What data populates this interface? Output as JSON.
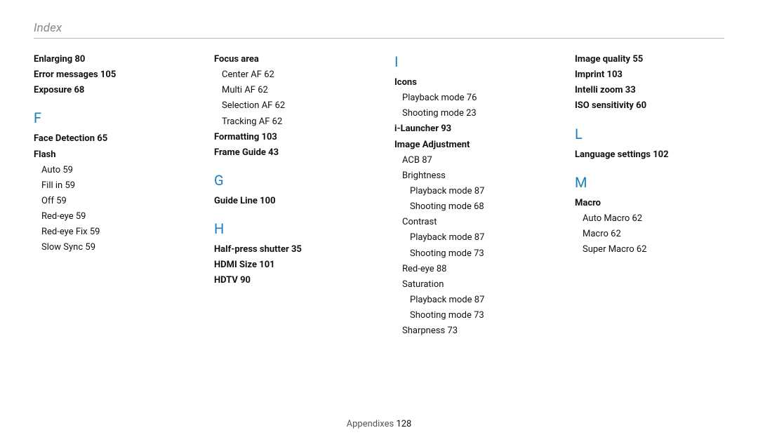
{
  "header": "Index",
  "footer_section": "Appendixes",
  "footer_page": "128",
  "col1": {
    "e1": {
      "label": "Enlarging",
      "page": "80"
    },
    "e2": {
      "label": "Error messages",
      "page": "105"
    },
    "e3": {
      "label": "Exposure",
      "page": "68"
    },
    "letter_f": "F",
    "f1": {
      "label": "Face Detection",
      "page": "65"
    },
    "f2": {
      "label": "Flash"
    },
    "f2a": {
      "label": "Auto",
      "page": "59"
    },
    "f2b": {
      "label": "Fill in",
      "page": "59"
    },
    "f2c": {
      "label": "Off",
      "page": "59"
    },
    "f2d": {
      "label": "Red-eye",
      "page": "59"
    },
    "f2e": {
      "label": "Red-eye Fix",
      "page": "59"
    },
    "f2f": {
      "label": "Slow Sync",
      "page": "59"
    }
  },
  "col2": {
    "f3": {
      "label": "Focus area"
    },
    "f3a": {
      "label": "Center AF",
      "page": "62"
    },
    "f3b": {
      "label": "Multi AF",
      "page": "62"
    },
    "f3c": {
      "label": "Selection AF",
      "page": "62"
    },
    "f3d": {
      "label": "Tracking AF",
      "page": "62"
    },
    "f4": {
      "label": "Formatting",
      "page": "103"
    },
    "f5": {
      "label": "Frame Guide",
      "page": "43"
    },
    "letter_g": "G",
    "g1": {
      "label": "Guide Line",
      "page": "100"
    },
    "letter_h": "H",
    "h1": {
      "label": "Half-press shutter",
      "page": "35"
    },
    "h2": {
      "label": "HDMI Size",
      "page": "101"
    },
    "h3": {
      "label": "HDTV",
      "page": "90"
    }
  },
  "col3": {
    "letter_i": "I",
    "i1": {
      "label": "Icons"
    },
    "i1a": {
      "label": "Playback mode",
      "page": "76"
    },
    "i1b": {
      "label": "Shooting mode",
      "page": "23"
    },
    "i2": {
      "label": "i-Launcher",
      "page": "93"
    },
    "i3": {
      "label": "Image Adjustment"
    },
    "i3a": {
      "label": "ACB",
      "page": "87"
    },
    "i3b": {
      "label": "Brightness"
    },
    "i3b1": {
      "label": "Playback mode",
      "page": "87"
    },
    "i3b2": {
      "label": "Shooting mode",
      "page": "68"
    },
    "i3c": {
      "label": "Contrast"
    },
    "i3c1": {
      "label": "Playback mode",
      "page": "87"
    },
    "i3c2": {
      "label": "Shooting mode",
      "page": "73"
    },
    "i3d": {
      "label": "Red-eye",
      "page": "88"
    },
    "i3e": {
      "label": "Saturation"
    },
    "i3e1": {
      "label": "Playback mode",
      "page": "87"
    },
    "i3e2": {
      "label": "Shooting mode",
      "page": "73"
    },
    "i3f": {
      "label": "Sharpness",
      "page": "73"
    }
  },
  "col4": {
    "i4": {
      "label": "Image quality",
      "page": "55"
    },
    "i5": {
      "label": "Imprint",
      "page": "103"
    },
    "i6": {
      "label": "Intelli zoom",
      "page": "33"
    },
    "i7": {
      "label": "ISO sensitivity",
      "page": "60"
    },
    "letter_l": "L",
    "l1": {
      "label": "Language settings",
      "page": "102"
    },
    "letter_m": "M",
    "m1": {
      "label": "Macro"
    },
    "m1a": {
      "label": "Auto Macro",
      "page": "62"
    },
    "m1b": {
      "label": "Macro",
      "page": "62"
    },
    "m1c": {
      "label": "Super Macro",
      "page": "62"
    }
  }
}
